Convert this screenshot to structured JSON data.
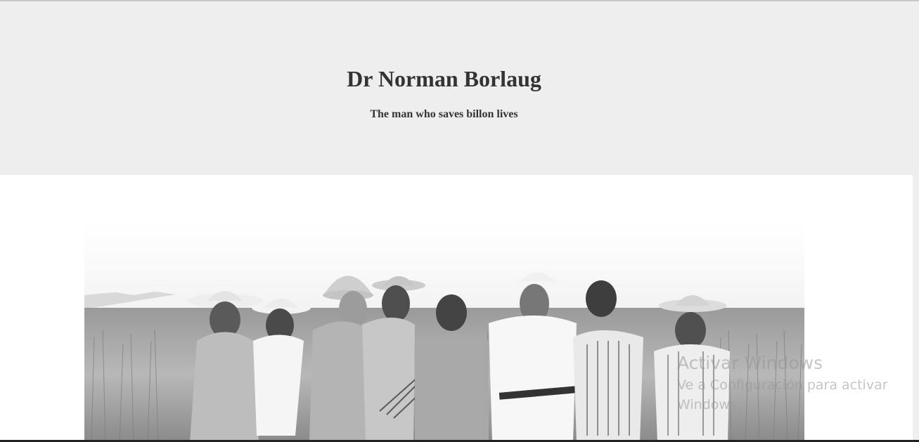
{
  "header": {
    "title": "Dr Norman Borlaug",
    "subtitle": "The man who saves billon lives"
  },
  "photo": {
    "alt": "Norman Borlaug with colleagues in a wheat field"
  },
  "watermark": {
    "title": "Activar Windows",
    "subtitle": "Ve a Configuración para activar Windows."
  },
  "colors": {
    "header_background": "#eeeeee",
    "text": "#333333",
    "content_background": "#ffffff"
  }
}
